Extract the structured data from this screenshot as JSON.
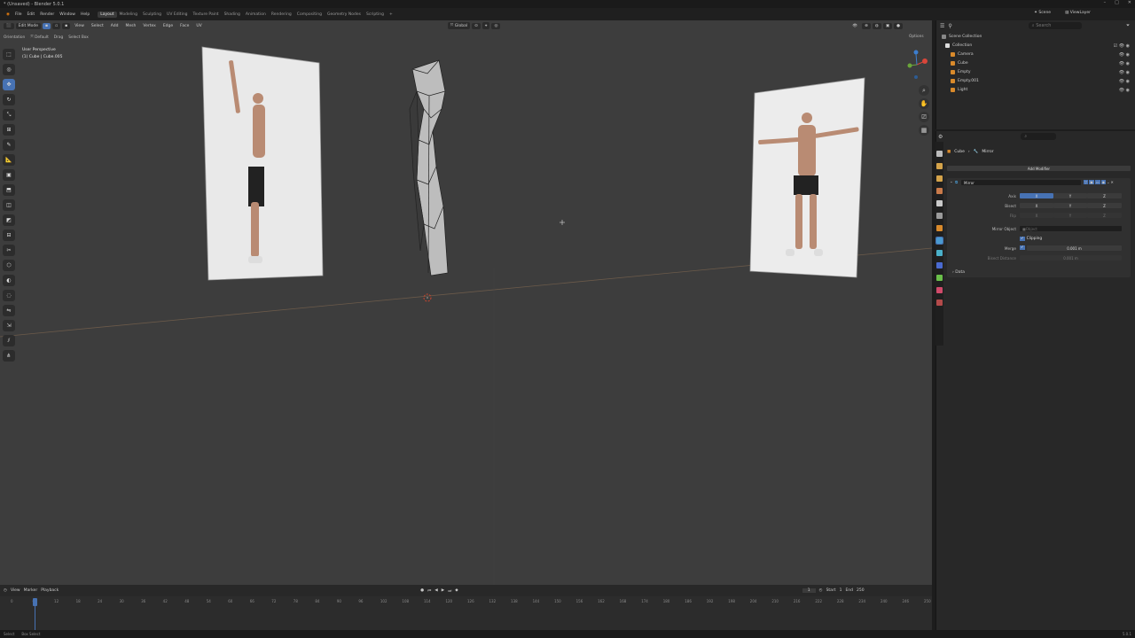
{
  "window": {
    "title": "* (Unsaved) - Blender 5.0.1",
    "controls": [
      "–",
      "□",
      "✕"
    ]
  },
  "menu": {
    "items": [
      "File",
      "Edit",
      "Render",
      "Window",
      "Help"
    ],
    "workspaces": [
      "Layout",
      "Modeling",
      "Sculpting",
      "UV Editing",
      "Texture Paint",
      "Shading",
      "Animation",
      "Rendering",
      "Compositing",
      "Geometry Nodes",
      "Scripting",
      "+"
    ],
    "active_workspace": "Layout",
    "scene": "Scene",
    "view_layer": "ViewLayer"
  },
  "viewport": {
    "mode": "Edit Mode",
    "menus": [
      "View",
      "Select",
      "Add",
      "Mesh",
      "Vertex",
      "Edge",
      "Face",
      "UV"
    ],
    "transform_orientation": "Global",
    "options_label": "Options",
    "orientation_label": "Orientation",
    "orientation_value": "Default",
    "drag_label": "Drag",
    "drag_value": "Select Box",
    "overlay_line1": "User Perspective",
    "overlay_line2": "(1) Cube | Cube.005"
  },
  "toolbar": {
    "tools": [
      "select-icon",
      "cursor-icon",
      "move-icon",
      "rotate-icon",
      "scale-icon",
      "transform-icon",
      "annotate-icon",
      "measure-icon",
      "add-cube-icon",
      "extrude-icon",
      "inset-icon",
      "bevel-icon",
      "loopcut-icon",
      "knife-icon",
      "polybuild-icon",
      "spin-icon",
      "smooth-icon",
      "edge-slide-icon",
      "shrink-icon",
      "shear-icon",
      "rip-icon"
    ]
  },
  "timeline": {
    "menus": [
      "View",
      "Marker",
      "Playback"
    ],
    "current_frame": "1",
    "start_label": "Start",
    "start_value": "1",
    "end_label": "End",
    "end_value": "250",
    "ticks": [
      "0",
      "6",
      "12",
      "18",
      "24",
      "30",
      "36",
      "42",
      "48",
      "54",
      "60",
      "66",
      "72",
      "78",
      "84",
      "90",
      "96",
      "102",
      "108",
      "114",
      "120",
      "126",
      "132",
      "138",
      "144",
      "150",
      "156",
      "162",
      "168",
      "174",
      "180",
      "186",
      "192",
      "198",
      "204",
      "210",
      "216",
      "222",
      "228",
      "234",
      "240",
      "246",
      "250"
    ]
  },
  "statusbar": {
    "left": "Select",
    "right_hint": "Box Select",
    "version": "5.0.1"
  },
  "outliner": {
    "search_placeholder": "Search",
    "root": "Scene Collection",
    "collection": "Collection",
    "items": [
      {
        "name": "Camera",
        "color": "#d98a2b"
      },
      {
        "name": "Cube",
        "color": "#d98a2b"
      },
      {
        "name": "Empty",
        "color": "#d98a2b"
      },
      {
        "name": "Empty.001",
        "color": "#d98a2b"
      },
      {
        "name": "Light",
        "color": "#d98a2b"
      }
    ]
  },
  "properties": {
    "breadcrumb_object": "Cube",
    "breadcrumb_modifier": "Mirror",
    "add_modifier": "Add Modifier",
    "modifier_name": "Mirror",
    "axis_label": "Axis",
    "bisect_label": "Bisect",
    "flip_label": "Flip",
    "axes": [
      "X",
      "Y",
      "Z"
    ],
    "mirror_object_label": "Mirror Object",
    "mirror_object_placeholder": "Object",
    "clipping_label": "Clipping",
    "merge_label": "Merge",
    "merge_value": "0.001 m",
    "bisect_distance_label": "Bisect Distance",
    "bisect_distance_value": "0.001 m",
    "data_label": "Data"
  },
  "colors": {
    "accent": "#4772b3",
    "viewport_bg": "#3d3d3d",
    "panel_bg": "#282828"
  }
}
